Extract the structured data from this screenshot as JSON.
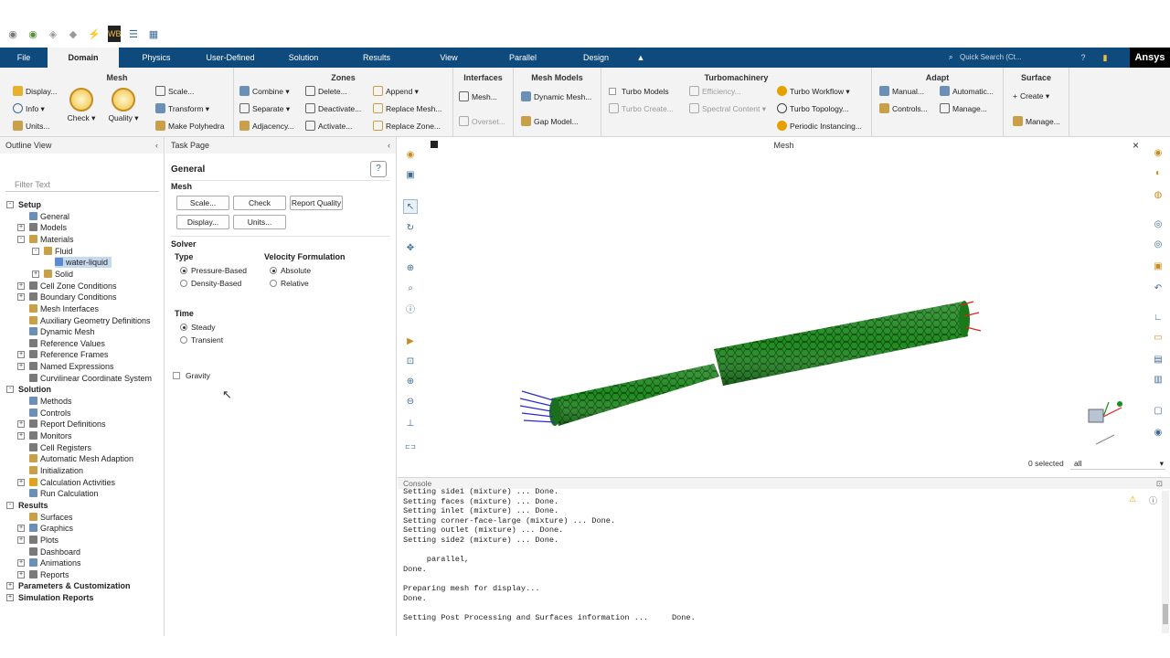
{
  "ribbon_tabs": [
    "File",
    "Domain",
    "Physics",
    "User-Defined",
    "Solution",
    "Results",
    "View",
    "Parallel",
    "Design"
  ],
  "active_tab": "Domain",
  "search_placeholder": "Quick Search (Ct...",
  "brand": "Ansys",
  "ribbon": {
    "mesh": {
      "title": "Mesh",
      "display": "Display...",
      "info": "Info",
      "units": "Units...",
      "check": "Check",
      "quality": "Quality",
      "scale": "Scale...",
      "transform": "Transform",
      "make_polyhedra": "Make Polyhedra"
    },
    "zones": {
      "title": "Zones",
      "combine": "Combine",
      "separate": "Separate",
      "adjacency": "Adjacency...",
      "delete": "Delete...",
      "deactivate": "Deactivate...",
      "activate": "Activate...",
      "append": "Append",
      "replace_mesh": "Replace Mesh...",
      "replace_zone": "Replace Zone..."
    },
    "interfaces": {
      "title": "Interfaces",
      "mesh": "Mesh...",
      "overset": "Overset..."
    },
    "mesh_models": {
      "title": "Mesh Models",
      "dynamic_mesh": "Dynamic Mesh...",
      "gap_model": "Gap Model..."
    },
    "turbomachinery": {
      "title": "Turbomachinery",
      "turbo_models": "Turbo Models",
      "turbo_create": "Turbo Create...",
      "efficiency": "Efficiency...",
      "spectral_content": "Spectral Content",
      "turbo_workflow": "Turbo Workflow",
      "turbo_topology": "Turbo Topology...",
      "periodic_instancing": "Periodic Instancing..."
    },
    "adapt": {
      "title": "Adapt",
      "manual": "Manual...",
      "controls": "Controls...",
      "automatic": "Automatic...",
      "manage": "Manage..."
    },
    "surface": {
      "title": "Surface",
      "create": "Create",
      "manage": "Manage..."
    }
  },
  "outline": {
    "title": "Outline View",
    "filter_placeholder": "Filter Text",
    "items": [
      {
        "label": "Setup",
        "bold": true,
        "level": 0,
        "exp": "-"
      },
      {
        "label": "General",
        "level": 1,
        "exp": "",
        "color": "#6b8fb5"
      },
      {
        "label": "Models",
        "level": 1,
        "exp": "+",
        "color": "#7a7a7a"
      },
      {
        "label": "Materials",
        "level": 1,
        "exp": "-",
        "color": "#c9a04a"
      },
      {
        "label": "Fluid",
        "level": 2,
        "exp": "-",
        "color": "#c9a04a"
      },
      {
        "label": "water-liquid",
        "level": 3,
        "exp": "",
        "color": "#5b8bd0",
        "selected": true
      },
      {
        "label": "Solid",
        "level": 2,
        "exp": "+",
        "color": "#c9a04a"
      },
      {
        "label": "Cell Zone Conditions",
        "level": 1,
        "exp": "+",
        "color": "#7a7a7a"
      },
      {
        "label": "Boundary Conditions",
        "level": 1,
        "exp": "+",
        "color": "#7a7a7a"
      },
      {
        "label": "Mesh Interfaces",
        "level": 1,
        "exp": "",
        "color": "#c9a04a"
      },
      {
        "label": "Auxiliary Geometry Definitions",
        "level": 1,
        "exp": "",
        "color": "#c9a04a"
      },
      {
        "label": "Dynamic Mesh",
        "level": 1,
        "exp": "",
        "color": "#6b8fb5"
      },
      {
        "label": "Reference Values",
        "level": 1,
        "exp": "",
        "color": "#7a7a7a"
      },
      {
        "label": "Reference Frames",
        "level": 1,
        "exp": "+",
        "color": "#7a7a7a"
      },
      {
        "label": "Named Expressions",
        "level": 1,
        "exp": "+",
        "color": "#7a7a7a"
      },
      {
        "label": "Curvilinear Coordinate System",
        "level": 1,
        "exp": "",
        "color": "#7a7a7a"
      },
      {
        "label": "Solution",
        "bold": true,
        "level": 0,
        "exp": "-"
      },
      {
        "label": "Methods",
        "level": 1,
        "exp": "",
        "color": "#6b8fb5"
      },
      {
        "label": "Controls",
        "level": 1,
        "exp": "",
        "color": "#6b8fb5"
      },
      {
        "label": "Report Definitions",
        "level": 1,
        "exp": "+",
        "color": "#7a7a7a"
      },
      {
        "label": "Monitors",
        "level": 1,
        "exp": "+",
        "color": "#7a7a7a"
      },
      {
        "label": "Cell Registers",
        "level": 1,
        "exp": "",
        "color": "#7a7a7a"
      },
      {
        "label": "Automatic Mesh Adaption",
        "level": 1,
        "exp": "",
        "color": "#c9a04a"
      },
      {
        "label": "Initialization",
        "level": 1,
        "exp": "",
        "color": "#c9a04a"
      },
      {
        "label": "Calculation Activities",
        "level": 1,
        "exp": "+",
        "color": "#e0a020"
      },
      {
        "label": "Run Calculation",
        "level": 1,
        "exp": "",
        "color": "#6b8fb5"
      },
      {
        "label": "Results",
        "bold": true,
        "level": 0,
        "exp": "-"
      },
      {
        "label": "Surfaces",
        "level": 1,
        "exp": "",
        "color": "#c9a04a"
      },
      {
        "label": "Graphics",
        "level": 1,
        "exp": "+",
        "color": "#6b8fb5"
      },
      {
        "label": "Plots",
        "level": 1,
        "exp": "+",
        "color": "#7a7a7a"
      },
      {
        "label": "Dashboard",
        "level": 1,
        "exp": "",
        "color": "#7a7a7a"
      },
      {
        "label": "Animations",
        "level": 1,
        "exp": "+",
        "color": "#6b8fb5"
      },
      {
        "label": "Reports",
        "level": 1,
        "exp": "+",
        "color": "#7a7a7a"
      },
      {
        "label": "Parameters & Customization",
        "bold": true,
        "level": 0,
        "exp": "+"
      },
      {
        "label": "Simulation Reports",
        "bold": true,
        "level": 0,
        "exp": "+"
      }
    ]
  },
  "task": {
    "header": "Task Page",
    "title": "General",
    "mesh_label": "Mesh",
    "scale": "Scale...",
    "check": "Check",
    "report_quality": "Report Quality",
    "display": "Display...",
    "units": "Units...",
    "solver_label": "Solver",
    "type_label": "Type",
    "pressure_based": "Pressure-Based",
    "density_based": "Density-Based",
    "velocity_label": "Velocity Formulation",
    "absolute": "Absolute",
    "relative": "Relative",
    "time_label": "Time",
    "steady": "Steady",
    "transient": "Transient",
    "gravity": "Gravity"
  },
  "graphics": {
    "title": "Mesh",
    "selected": "0 selected",
    "filter_value": "all"
  },
  "console": {
    "title": "Console",
    "lines": [
      "Setting side1 (mixture) ... Done.",
      "Setting faces (mixture) ... Done.",
      "Setting inlet (mixture) ... Done.",
      "Setting corner-face-large (mixture) ... Done.",
      "Setting outlet (mixture) ... Done.",
      "Setting side2 (mixture) ... Done.",
      "",
      "     parallel,",
      "Done.",
      "",
      "Preparing mesh for display...",
      "Done.",
      "",
      "Setting Post Processing and Surfaces information ...     Done."
    ]
  },
  "colors": {
    "ribbon_blue": "#0f4a7d",
    "mesh_green": "#1f8a1f",
    "inlet_blue": "#2a2ad0",
    "outlet_red": "#e02020"
  }
}
